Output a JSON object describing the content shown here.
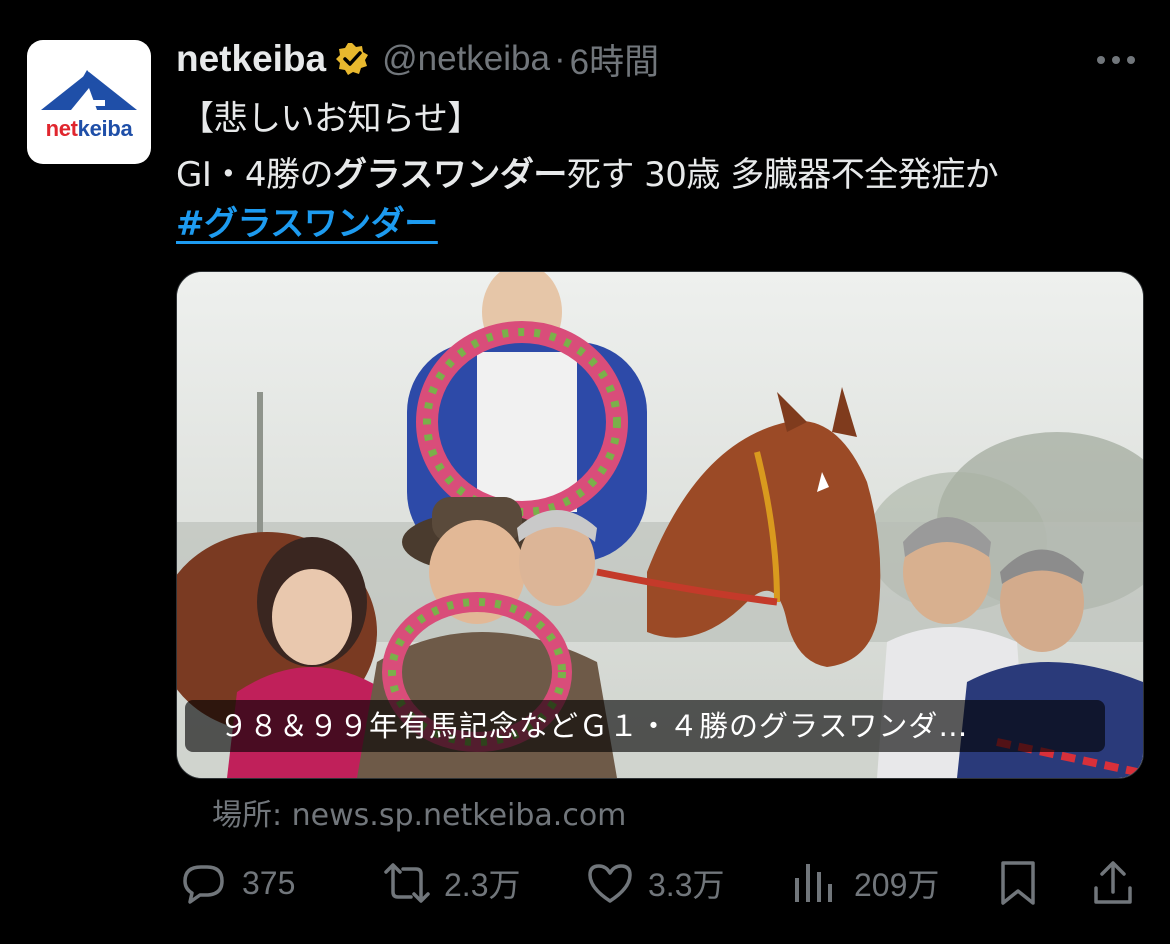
{
  "account": {
    "avatar_logo_text_net": "net",
    "avatar_logo_text_keiba": "keiba",
    "display_name": "netkeiba",
    "handle": "@netkeiba",
    "separator": "·",
    "time": "6時間",
    "verified": true
  },
  "tweet": {
    "line1": "【悲しいお知らせ】",
    "line2_prefix": "GI・4勝の",
    "line2_bold": "グラスワンダー",
    "line2_suffix": "死す 30歳 多臓器不全発症か",
    "hashtag": "#グラスワンダー"
  },
  "card": {
    "caption": "９８＆９９年有馬記念などＧ１・４勝のグラスワンダ…",
    "source_label": "場所:",
    "source_domain": "news.sp.netkeiba.com"
  },
  "actions": {
    "reply_count": "375",
    "retweet_count": "2.3万",
    "like_count": "3.3万",
    "views_count": "209万"
  },
  "colors": {
    "background": "#000000",
    "text": "#e7e9ea",
    "muted": "#71767b",
    "link": "#1d9bf0",
    "verified_gold": "#e8b82e"
  },
  "icons": [
    "more-icon",
    "verified-badge-icon",
    "reply-icon",
    "retweet-icon",
    "like-icon",
    "views-icon",
    "bookmark-icon",
    "share-icon"
  ]
}
